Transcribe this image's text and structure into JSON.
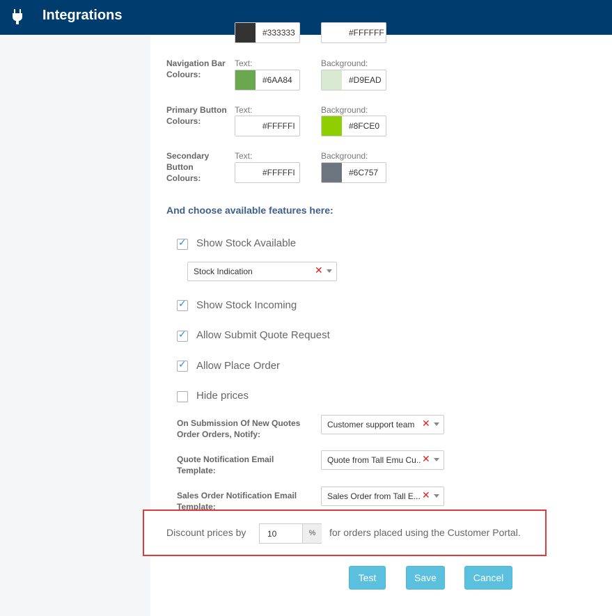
{
  "header": {
    "title": "Integrations",
    "icon": "plug-icon"
  },
  "colours": {
    "row0": {
      "text_hex": "#333333",
      "text_swatch": "#333333",
      "bg_hex": "#FFFFFF",
      "bg_swatch": "#ffffff"
    },
    "nav_bar": {
      "label": "Navigation Bar Colours:",
      "text_label": "Text:",
      "text_hex": "#6AA84",
      "text_swatch": "#6aa84f",
      "bg_label": "Background:",
      "bg_hex": "#D9EAD",
      "bg_swatch": "#d9ead3"
    },
    "primary_button": {
      "label": "Primary Button Colours:",
      "text_label": "Text:",
      "text_hex": "#FFFFFI",
      "text_swatch": "#ffffff",
      "bg_label": "Background:",
      "bg_hex": "#8FCE0",
      "bg_swatch": "#8fce00"
    },
    "secondary_button": {
      "label": "Secondary Button Colours:",
      "text_label": "Text:",
      "text_hex": "#FFFFFI",
      "text_swatch": "#ffffff",
      "bg_label": "Background:",
      "bg_hex": "#6C757",
      "bg_swatch": "#6c757d"
    }
  },
  "features": {
    "heading": "And choose available features here:",
    "show_stock_available": {
      "label": "Show Stock Available",
      "checked": true
    },
    "stock_indication_select": {
      "value": "Stock Indication"
    },
    "show_stock_incoming": {
      "label": "Show Stock Incoming",
      "checked": true
    },
    "allow_submit_quote": {
      "label": "Allow Submit Quote Request",
      "checked": true
    },
    "allow_place_order": {
      "label": "Allow Place Order",
      "checked": true
    },
    "hide_prices": {
      "label": "Hide prices",
      "checked": false
    },
    "notify": {
      "label": "On Submission Of New Quotes Order Orders, Notify:",
      "value": "Customer support team"
    },
    "quote_template": {
      "label": "Quote Notification Email Template:",
      "value": "Quote from Tall Emu Cu..."
    },
    "sales_template": {
      "label": "Sales Order Notification Email Template:",
      "value": "Sales Order from Tall E..."
    }
  },
  "discount": {
    "prefix": "Discount prices by",
    "value": "10",
    "unit": "%",
    "suffix": "for orders placed using the Customer Portal."
  },
  "buttons": {
    "test": "Test",
    "save": "Save",
    "cancel": "Cancel"
  },
  "highlight_color": "#e0393b"
}
